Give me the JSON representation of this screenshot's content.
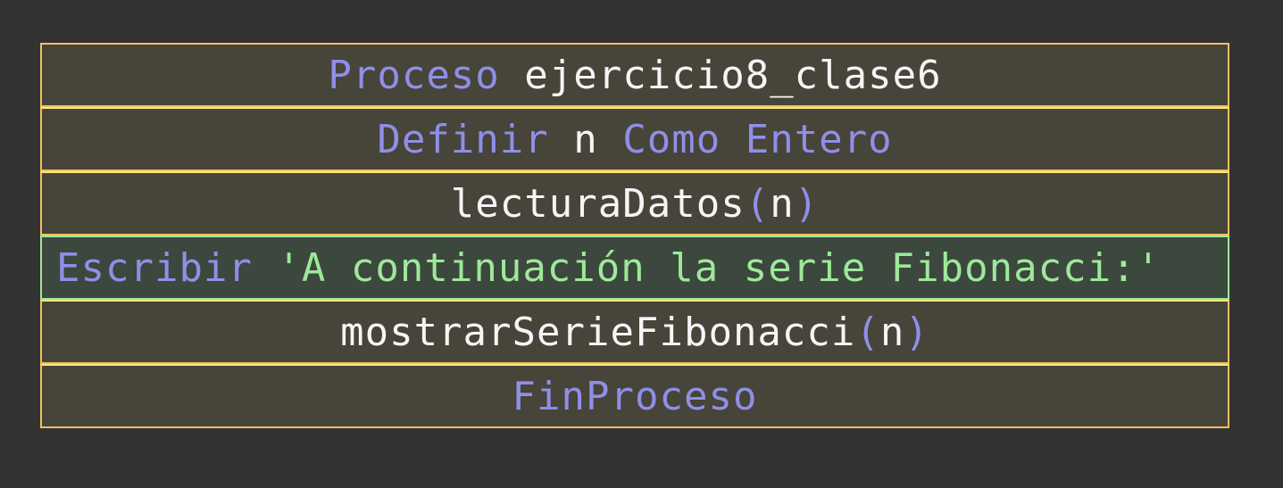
{
  "diagram": {
    "rows": [
      {
        "parts": [
          {
            "text": "Proceso",
            "kind": "keyword"
          },
          {
            "text": " ejercicio8_clase6",
            "kind": "identifier"
          }
        ]
      },
      {
        "parts": [
          {
            "text": "Definir",
            "kind": "keyword"
          },
          {
            "text": " n ",
            "kind": "identifier"
          },
          {
            "text": "Como Entero",
            "kind": "keyword"
          }
        ]
      },
      {
        "parts": [
          {
            "text": "lecturaDatos",
            "kind": "identifier"
          },
          {
            "text": "(",
            "kind": "keyword"
          },
          {
            "text": "n",
            "kind": "identifier"
          },
          {
            "text": ")",
            "kind": "keyword"
          }
        ]
      },
      {
        "parts": [
          {
            "text": "Escribir",
            "kind": "keyword"
          },
          {
            "text": " 'A continuación la serie Fibonacci:'",
            "kind": "string"
          }
        ]
      },
      {
        "parts": [
          {
            "text": "mostrarSerieFibonacci",
            "kind": "identifier"
          },
          {
            "text": "(",
            "kind": "keyword"
          },
          {
            "text": "n",
            "kind": "identifier"
          },
          {
            "text": ")",
            "kind": "keyword"
          }
        ]
      },
      {
        "parts": [
          {
            "text": "FinProceso",
            "kind": "keyword"
          }
        ]
      }
    ]
  },
  "colors": {
    "background": "#333333",
    "block_fill": "#47443a",
    "write_fill": "#3c473e",
    "outer_border": "#f0c060",
    "inner_divider": "#f5e97a",
    "write_border": "#9ee89a",
    "keyword": "#8f8fe8",
    "identifier": "#f5f5f5",
    "string": "#9ee89a"
  }
}
